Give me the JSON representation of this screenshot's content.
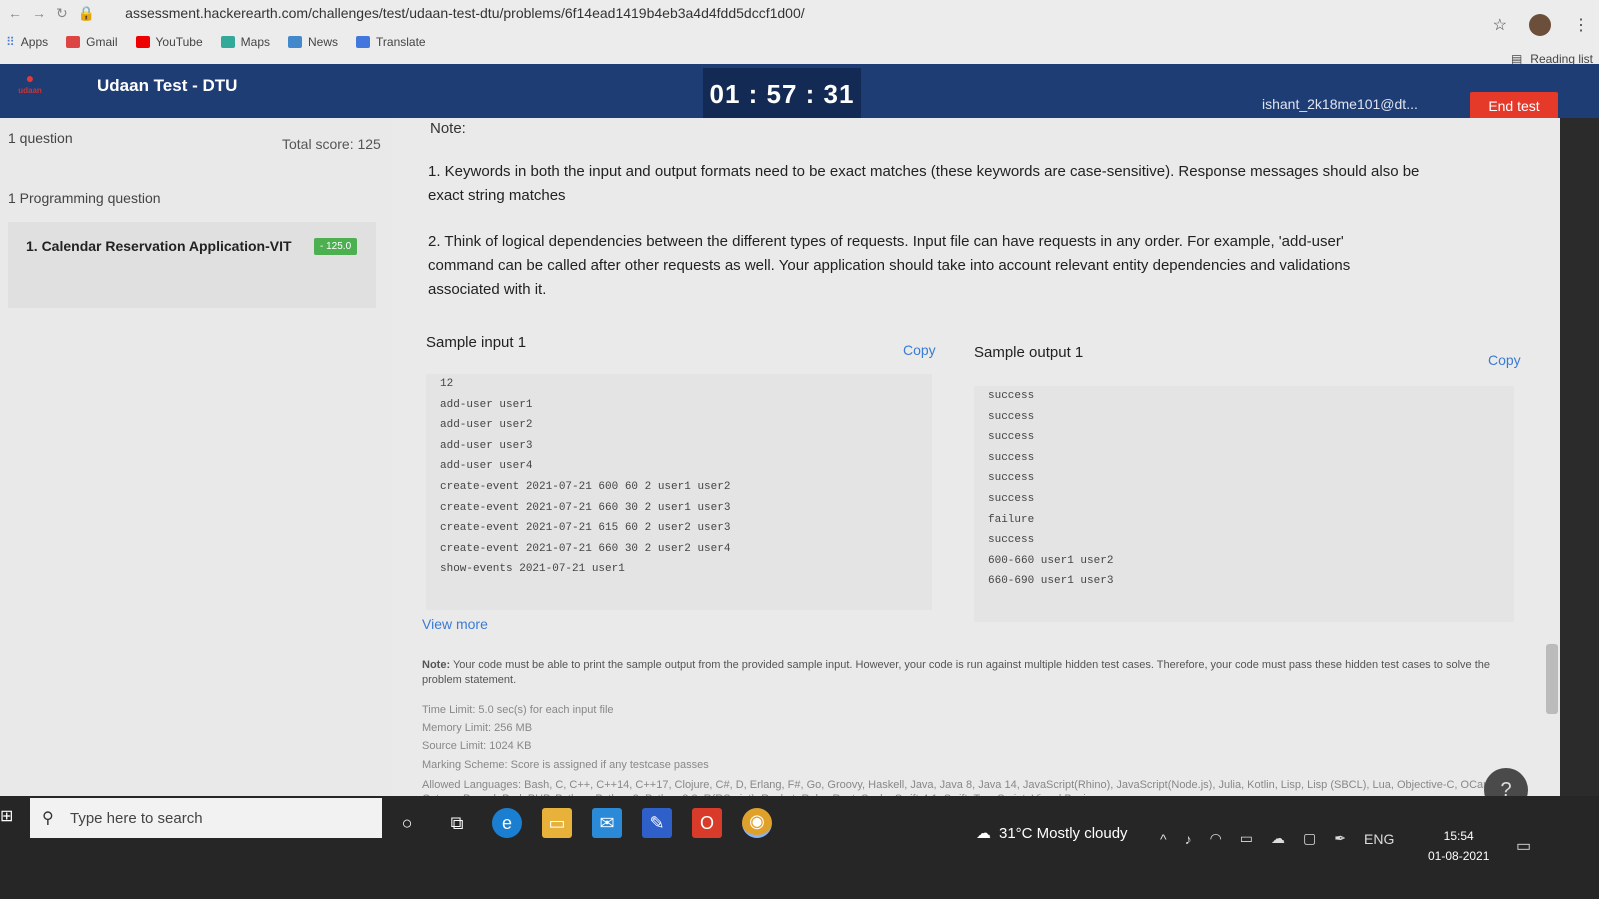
{
  "browser": {
    "url": "assessment.hackerearth.com/challenges/test/udaan-test-dtu/problems/6f14ead1419b4eb3a4d4fdd5dccf1d00/",
    "bookmarks": [
      "Apps",
      "Gmail",
      "YouTube",
      "Maps",
      "News",
      "Translate"
    ],
    "reading_list": "Reading list"
  },
  "header": {
    "title": "Udaan Test - DTU",
    "timer": "01 : 57 : 31",
    "user": "ishant_2k18me101@dt...",
    "end_test": "End test"
  },
  "sidebar": {
    "question_count": "1 question",
    "total_score": "Total score: 125",
    "section": "1 Programming question",
    "items": [
      {
        "label": "1.  Calendar Reservation Application-VIT",
        "score": "- 125.0"
      }
    ]
  },
  "problem": {
    "note_heading": "Note:",
    "point1_line1": "1. Keywords in both the input and output formats need to be exact matches (these keywords are case-sensitive). Response messages should also be",
    "point1_line2": "exact string matches",
    "point2_line1": "2. Think of logical dependencies between the different types of requests. Input file can have requests in any order. For example, 'add-user'",
    "point2_line2": "command can be called after other requests as well. Your application should take into account relevant entity dependencies and validations",
    "point2_line3": "associated with it.",
    "sample_input_label": "Sample input 1",
    "sample_output_label": "Sample output 1",
    "copy_label": "Copy",
    "sample_input": [
      "12",
      "add-user user1",
      "add-user user2",
      "add-user user3",
      "add-user user4",
      "create-event 2021-07-21 600 60 2 user1 user2",
      "create-event 2021-07-21 660 30 2 user1 user3",
      "create-event 2021-07-21 615 60 2 user2 user3",
      "create-event 2021-07-21 660 30 2 user2 user4",
      "show-events 2021-07-21 user1"
    ],
    "sample_output": [
      "success",
      "success",
      "success",
      "success",
      "success",
      "success",
      "failure",
      "success",
      "600-660 user1 user2",
      "660-690 user1 user3"
    ],
    "view_more": "View more",
    "footer_note_label": "Note:",
    "footer_note": "Your code must be able to print the sample output from the provided sample input. However, your code is run against multiple hidden test cases. Therefore, your code must pass these hidden test cases to solve the problem statement.",
    "time_limit": "Time Limit: 5.0 sec(s) for each input file",
    "memory_limit": "Memory Limit: 256 MB",
    "source_limit": "Source Limit: 1024 KB",
    "marking_scheme": "Marking Scheme: Score is assigned if any testcase passes",
    "allowed_languages": "Allowed Languages: Bash, C, C++, C++14, C++17, Clojure, C#, D, Erlang, F#, Go, Groovy, Haskell, Java, Java 8, Java 14, JavaScript(Rhino), JavaScript(Node.js), Julia, Kotlin, Lisp, Lisp (SBCL), Lua, Objective-C, OCaml, Octave, Pascal, Perl, PHP, Python, Python 3, Python 3.8, R(RScript), Racket, Ruby, Rust, Scala, Swift-4.1, Swift, TypeScript, Visual Basic"
  },
  "taskbar": {
    "search_placeholder": "Type here to search",
    "weather": "31°C  Mostly cloudy",
    "lang": "ENG",
    "time": "15:54",
    "date": "01-08-2021"
  },
  "colors": {
    "header_bg": "#1f3d75",
    "timer_bg": "#132a55",
    "end_button": "#e53a2a",
    "link": "#3a7bd5",
    "score_badge": "#4caf50"
  }
}
